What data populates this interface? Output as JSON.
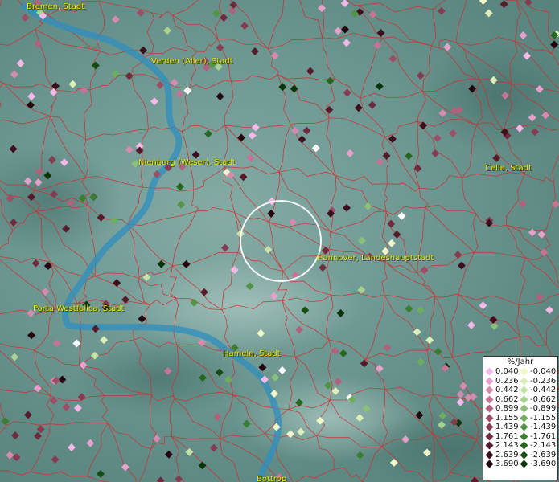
{
  "map": {
    "cities": [
      {
        "name": "Bremen, Stadt",
        "key": "bremen"
      },
      {
        "name": "Verden (Aller), Stadt",
        "key": "verden"
      },
      {
        "name": "Nienburg (Weser), Stadt",
        "key": "nienburg"
      },
      {
        "name": "Celle, Stadt",
        "key": "celle"
      },
      {
        "name": "Hannover, Landeshauptstadt",
        "key": "hannover"
      },
      {
        "name": "Porta Westfalica, Stadt",
        "key": "porta"
      },
      {
        "name": "Hameln, Stadt",
        "key": "hameln"
      },
      {
        "name": "Bottrop",
        "key": "bottom"
      }
    ],
    "colors": {
      "river": "#2f8fbf",
      "borders": "#d42a2a",
      "label": "#e8e800",
      "highlight_circle": "#ffffff"
    }
  },
  "legend": {
    "title": "%/Jahr",
    "rows": [
      {
        "pos": "0.040",
        "pos_color": "#f5b8e8",
        "neg": "-0.040",
        "neg_color": "#f0f7c8"
      },
      {
        "pos": "0.236",
        "pos_color": "#e6a0cc",
        "neg": "-0.236",
        "neg_color": "#dcefb8"
      },
      {
        "pos": "0.442",
        "pos_color": "#d58ab0",
        "neg": "-0.442",
        "neg_color": "#c5e2a6"
      },
      {
        "pos": "0.662",
        "pos_color": "#c47596",
        "neg": "-0.662",
        "neg_color": "#a9d290"
      },
      {
        "pos": "0.899",
        "pos_color": "#b2617d",
        "neg": "-0.899",
        "neg_color": "#8cc076"
      },
      {
        "pos": "1.155",
        "pos_color": "#9d4e66",
        "neg": "-1.155",
        "neg_color": "#6fac5d"
      },
      {
        "pos": "1.439",
        "pos_color": "#873b51",
        "neg": "-1.439",
        "neg_color": "#529544"
      },
      {
        "pos": "1.761",
        "pos_color": "#6f2a3d",
        "neg": "-1.761",
        "neg_color": "#3a7e30"
      },
      {
        "pos": "2.143",
        "pos_color": "#561b2b",
        "neg": "-2.143",
        "neg_color": "#27661f"
      },
      {
        "pos": "2.639",
        "pos_color": "#3d0f1c",
        "neg": "-2.639",
        "neg_color": "#174d12"
      },
      {
        "pos": "3.690",
        "pos_color": "#24060f",
        "neg": "-3.690",
        "neg_color": "#0b3408"
      }
    ]
  }
}
